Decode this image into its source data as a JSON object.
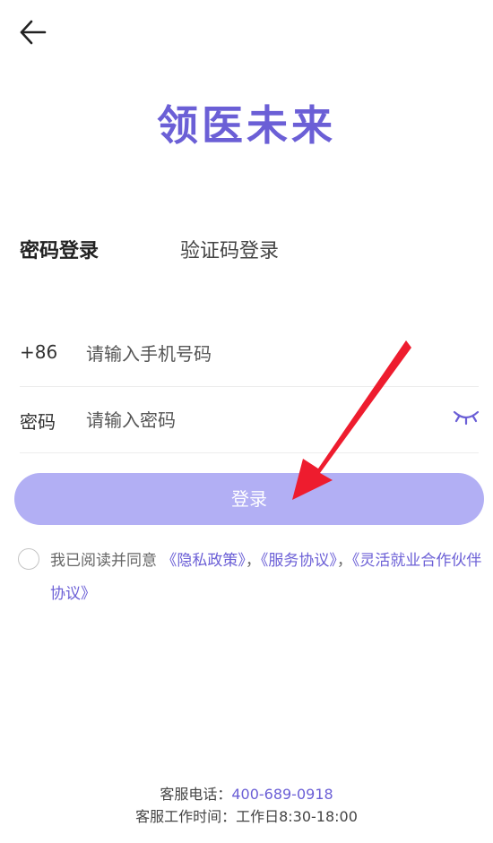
{
  "header": {
    "back_icon": "arrow-left-icon",
    "app_title": "领医未来"
  },
  "tabs": [
    {
      "label": "密码登录",
      "active": true
    },
    {
      "label": "验证码登录",
      "active": false
    }
  ],
  "form": {
    "phone": {
      "prefix": "+86",
      "placeholder": "请输入手机号码",
      "value": ""
    },
    "password": {
      "label": "密码",
      "placeholder": "请输入密码",
      "value": "",
      "toggle_icon": "eye-closed-icon"
    }
  },
  "login_button": {
    "label": "登录"
  },
  "agreement": {
    "prefix": "我已阅读并同意",
    "privacy": "《隐私政策》",
    "sep1": "，",
    "service": "《服务协议》",
    "sep2": "，",
    "partner": "《灵活就业合作伙伴协议》",
    "checked": false
  },
  "footer": {
    "phone_label": "客服电话：",
    "phone_number": "400-689-0918",
    "hours_label": "客服工作时间：",
    "hours_value": "工作日8:30-18:00"
  },
  "colors": {
    "brand": "#6b5fd6",
    "button": "#b2aff4",
    "annotation_arrow": "#ee1c2e"
  }
}
